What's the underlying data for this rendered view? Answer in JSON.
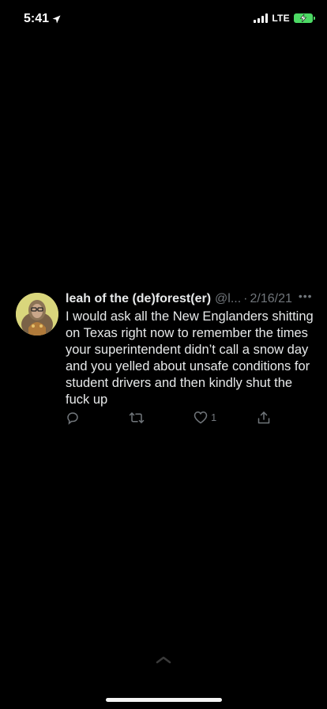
{
  "status_bar": {
    "time": "5:41",
    "network": "LTE",
    "location_icon": "location-arrow-icon",
    "signal_icon": "cellular-signal-icon",
    "battery_icon": "battery-charging-icon",
    "battery_color": "#4cd964"
  },
  "tweet": {
    "display_name": "leah of the (de)forest(er)",
    "handle": "@l...",
    "separator": "·",
    "date": "2/16/21",
    "more_icon": "more-dots-icon",
    "text": "I would ask all the New Englanders shitting\non Texas right now to remember the times\nyour superintendent didn’t call a snow day\nand you yelled about unsafe conditions for\nstudent drivers and then kindly shut the\nfuck up",
    "actions": {
      "reply_icon": "reply-icon",
      "retweet_icon": "retweet-icon",
      "like_icon": "heart-icon",
      "like_count": "1",
      "share_icon": "share-icon"
    }
  },
  "bottom": {
    "chevron_icon": "chevron-up-icon",
    "home_indicator": "home-indicator"
  },
  "colors": {
    "background": "#000000",
    "text_primary": "#e7e9ea",
    "text_secondary": "#71767b"
  }
}
